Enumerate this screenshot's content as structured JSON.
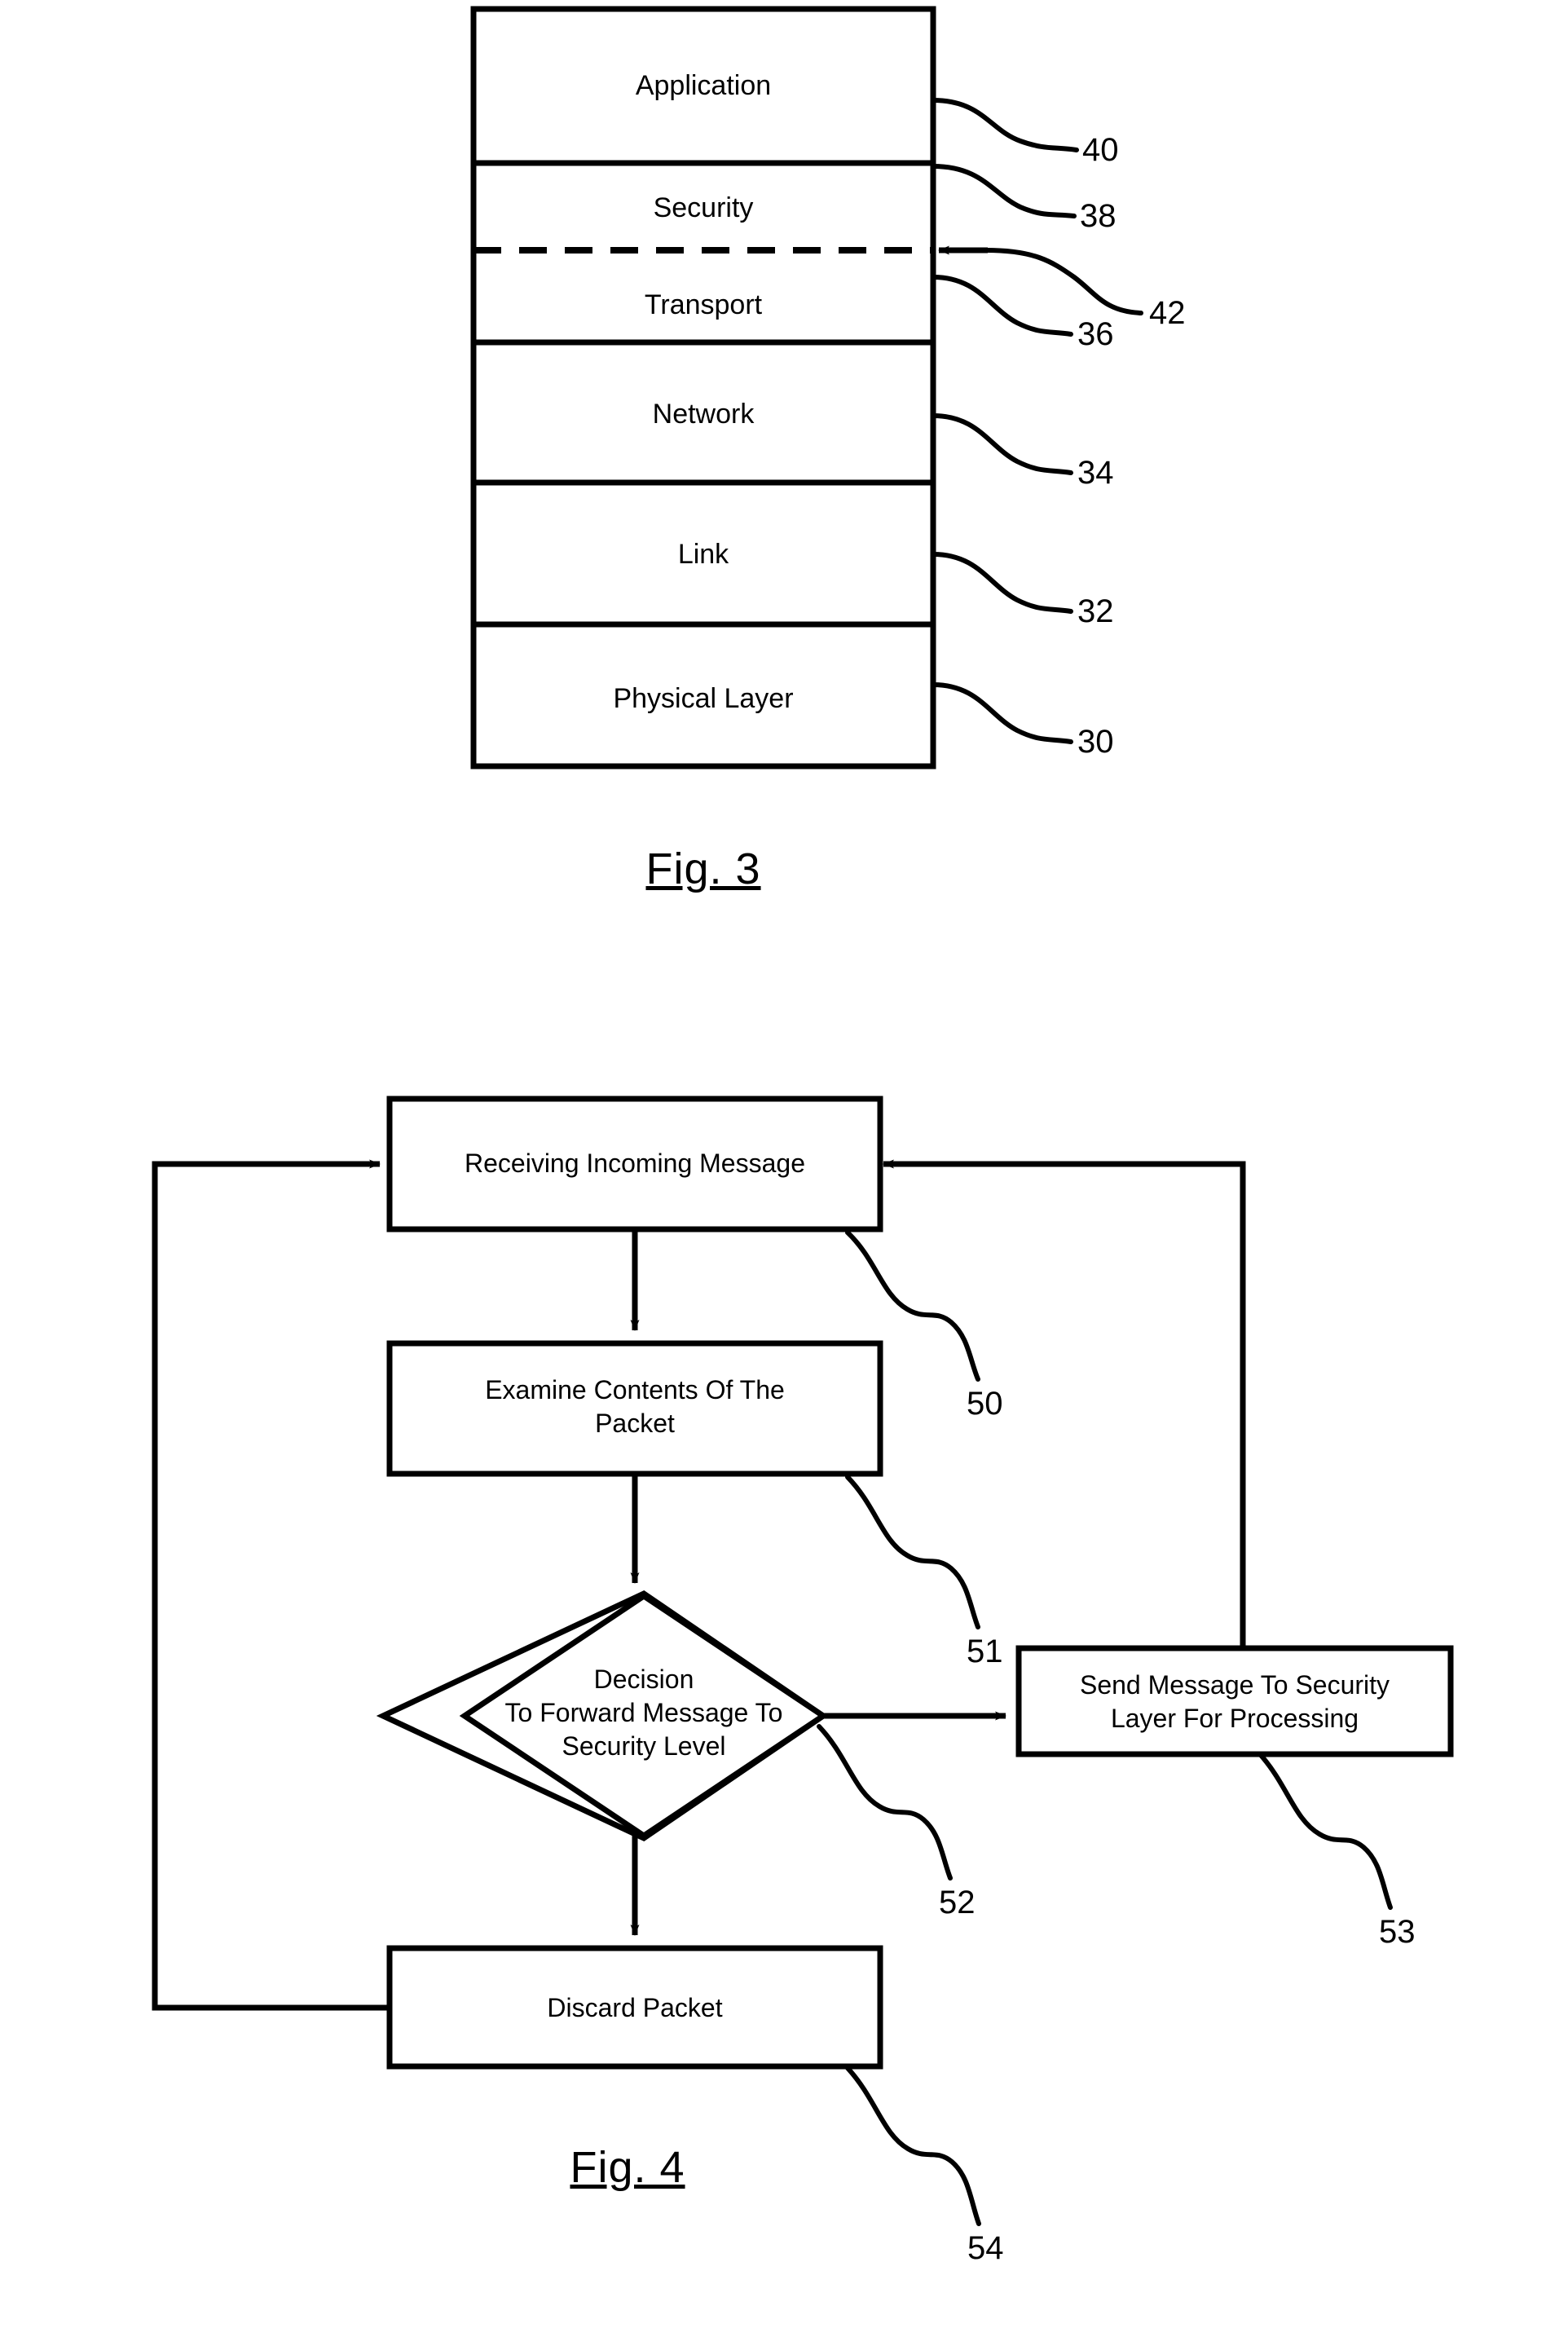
{
  "figure3": {
    "caption": "Fig. 3",
    "title_semantic": "protocol-stack-diagram",
    "layers": [
      {
        "label": "Application",
        "ref": "40"
      },
      {
        "label": "Security",
        "ref": "38"
      },
      {
        "label": "Transport",
        "ref": "36"
      },
      {
        "label": "Network",
        "ref": "34"
      },
      {
        "label": "Link",
        "ref": "32"
      },
      {
        "label": "Physical Layer",
        "ref": "30"
      }
    ],
    "boundary_ref": "42",
    "boundary_style": "dashed"
  },
  "figure4": {
    "caption": "Fig. 4",
    "title_semantic": "message-processing-flowchart",
    "nodes": [
      {
        "id": "n50",
        "shape": "rect",
        "label": "Receiving Incoming Message",
        "ref": "50"
      },
      {
        "id": "n51",
        "shape": "rect",
        "label": "Examine Contents Of The Packet",
        "ref": "51",
        "lines": [
          "Examine Contents Of The",
          "Packet"
        ]
      },
      {
        "id": "n52",
        "shape": "diamond",
        "label": "Decision To Forward Message To Security Level",
        "ref": "52",
        "lines": [
          "Decision",
          "To Forward Message To",
          "Security Level"
        ]
      },
      {
        "id": "n53",
        "shape": "rect",
        "label": "Send Message To Security Layer For Processing",
        "ref": "53",
        "lines": [
          "Send Message To Security",
          "Layer For Processing"
        ]
      },
      {
        "id": "n54",
        "shape": "rect",
        "label": "Discard Packet",
        "ref": "54"
      }
    ],
    "edges": [
      {
        "from": "n50",
        "to": "n51",
        "type": "arrow-down"
      },
      {
        "from": "n51",
        "to": "n52",
        "type": "arrow-down"
      },
      {
        "from": "n52",
        "to": "n53",
        "type": "arrow-right"
      },
      {
        "from": "n52",
        "to": "n54",
        "type": "arrow-down"
      },
      {
        "from": "n53",
        "to": "n50",
        "type": "feedback-right"
      },
      {
        "from": "n54",
        "to": "n50",
        "type": "feedback-left"
      }
    ]
  },
  "style": {
    "ink": "#000000",
    "paper": "#ffffff"
  }
}
